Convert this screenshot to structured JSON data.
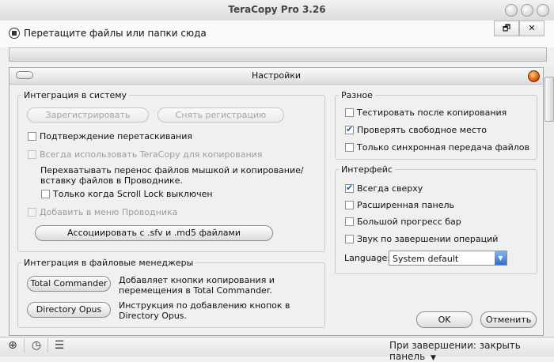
{
  "window": {
    "title": "TeraCopy Pro 3.26"
  },
  "dropzone": {
    "text": "Перетащите файлы или папки сюда"
  },
  "toolbar": {
    "restore_glyph": "🗗",
    "close_glyph": "✕"
  },
  "dialog": {
    "title": "Настройки",
    "integration": {
      "legend": "Интеграция в систему",
      "register_button": "Зарегистрировать",
      "unregister_button": "Снять регистрацию",
      "confirm_drag": {
        "label": "Подтверждение перетаскивания",
        "checked": false,
        "enabled": true
      },
      "always_use": {
        "label": "Всегда использовать TeraCopy для копирования",
        "checked": false,
        "enabled": false
      },
      "intercept_text": "Перехватывать перенос файлов мышкой и копирование/вставку файлов в Проводнике.",
      "scroll_lock": {
        "label": "Только когда Scroll Lock выключен",
        "checked": false,
        "enabled": true
      },
      "explorer_menu": {
        "label": "Добавить в меню Проводника",
        "checked": false,
        "enabled": false
      },
      "associate_button": "Ассоциировать с .sfv и .md5 файлами"
    },
    "file_managers": {
      "legend": "Интеграция в файловые менеджеры",
      "total_commander_button": "Total Commander",
      "total_commander_text": "Добавляет кнопки копирования и перемещения в Total Commander.",
      "directory_opus_button": "Directory Opus",
      "directory_opus_text": "Инструкция по добавлению кнопок в Directory Opus."
    },
    "misc": {
      "legend": "Разное",
      "test_after_copy": {
        "label": "Тестировать после копирования",
        "checked": false
      },
      "check_free_space": {
        "label": "Проверять свободное место",
        "checked": true
      },
      "sync_only": {
        "label": "Только синхронная передача файлов",
        "checked": false
      }
    },
    "interface": {
      "legend": "Интерфейс",
      "always_on_top": {
        "label": "Всегда сверху",
        "checked": true
      },
      "extended_panel": {
        "label": "Расширенная панель",
        "checked": false
      },
      "big_progress": {
        "label": "Большой прогресс бар",
        "checked": false
      },
      "sound_on_finish": {
        "label": "Звук по завершении операций",
        "checked": false
      },
      "language_label": "Language:",
      "language_value": "System default"
    },
    "ok_button": "OK",
    "cancel_button": "Отменить"
  },
  "statusbar": {
    "on_finish": "При завершении: закрыть панель"
  }
}
